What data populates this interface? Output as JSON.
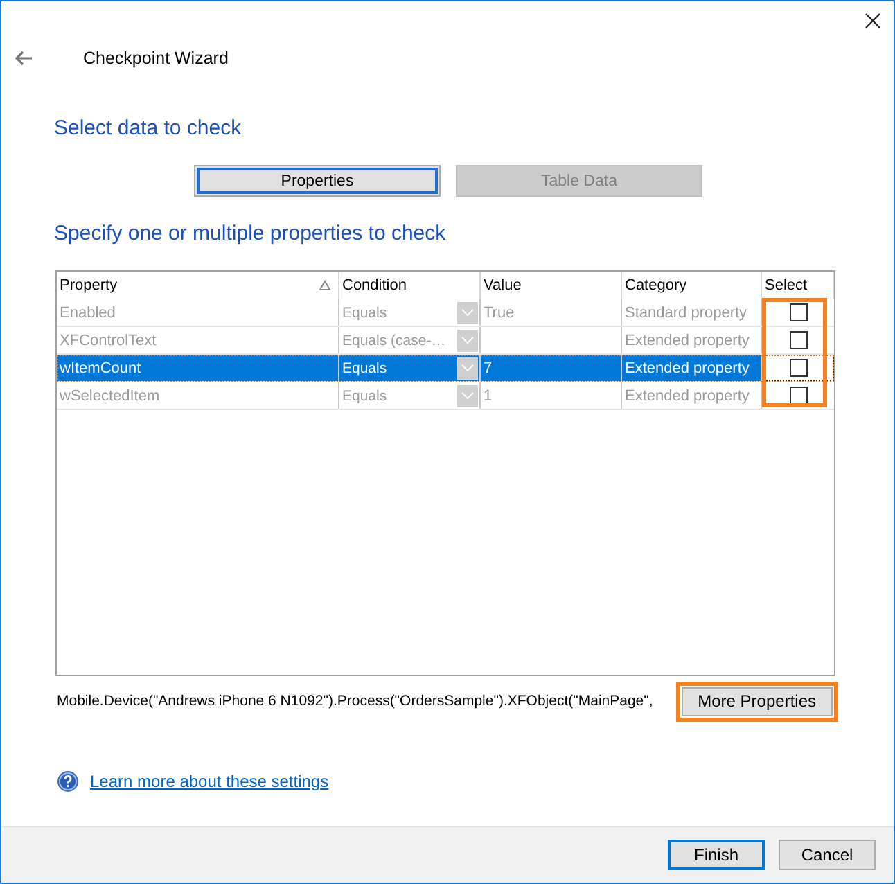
{
  "window": {
    "title": "Checkpoint Wizard"
  },
  "heading": "Select data to check",
  "tabs": [
    {
      "label": "Properties",
      "selected": true,
      "disabled": false
    },
    {
      "label": "Table Data",
      "selected": false,
      "disabled": true
    }
  ],
  "subheading": "Specify one or multiple properties to check",
  "table": {
    "columns": [
      {
        "label": "Property",
        "sorted": true
      },
      {
        "label": "Condition",
        "sorted": false
      },
      {
        "label": "Value",
        "sorted": false
      },
      {
        "label": "Category",
        "sorted": false
      },
      {
        "label": "Select",
        "sorted": false
      }
    ],
    "select_highlighted": true,
    "rows": [
      {
        "property": "Enabled",
        "condition": "Equals",
        "value": "True",
        "category": "Standard property",
        "checked": false,
        "selected": false,
        "disabled": true
      },
      {
        "property": "XFControlText",
        "condition": "Equals (case-…",
        "value": "",
        "category": "Extended property",
        "checked": false,
        "selected": false,
        "disabled": true
      },
      {
        "property": "wItemCount",
        "condition": "Equals",
        "value": "7",
        "category": "Extended property",
        "checked": false,
        "selected": true,
        "disabled": false
      },
      {
        "property": "wSelectedItem",
        "condition": "Equals",
        "value": "1",
        "category": "Extended property",
        "checked": false,
        "selected": false,
        "disabled": true
      }
    ]
  },
  "object_path": "Mobile.Device(\"Andrews iPhone 6 N1092\").Process(\"OrdersSample\").XFObject(\"MainPage\",",
  "more_button": {
    "label": "More Properties",
    "highlighted": true
  },
  "help_link": "Learn more about these settings",
  "buttons": [
    {
      "label": "Finish",
      "default": true
    },
    {
      "label": "Cancel",
      "default": false
    }
  ]
}
